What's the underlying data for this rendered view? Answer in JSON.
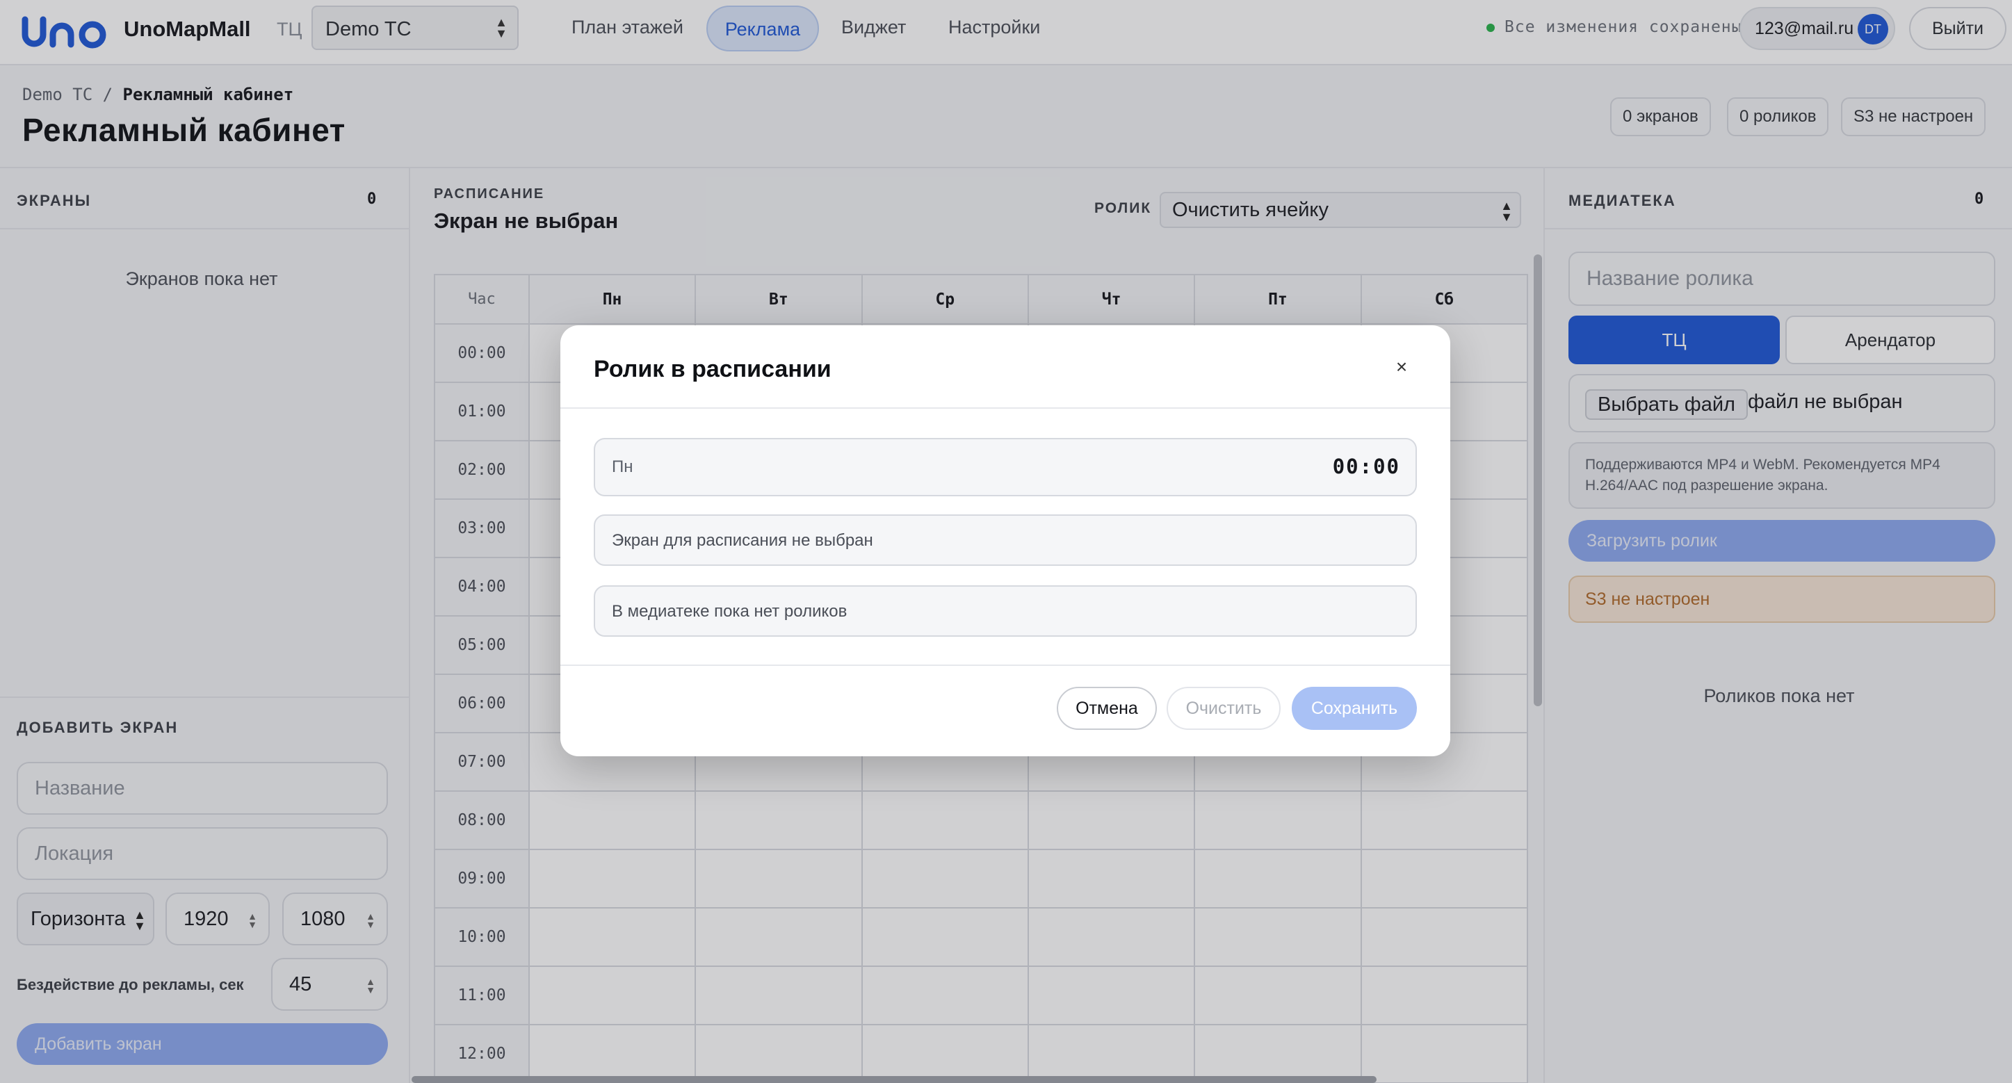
{
  "header": {
    "brand": "UnoMapMall",
    "tc_label": "ТЦ",
    "tc_selected": "Demo TC",
    "nav": [
      "План этажей",
      "Реклама",
      "Виджет",
      "Настройки"
    ],
    "nav_active": "Реклама",
    "saved_status": "Все изменения сохранены",
    "user_email": "123@mail.ru",
    "user_initials": "DT",
    "logout": "Выйти"
  },
  "page": {
    "breadcrumb_root": "Demo TC",
    "breadcrumb_sep": "/",
    "breadcrumb_current": "Рекламный кабинет",
    "title": "Рекламный кабинет",
    "stats": [
      "0 экранов",
      "0 роликов",
      "S3 не настроен"
    ]
  },
  "screens": {
    "title": "ЭКРАНЫ",
    "count": "0",
    "empty": "Экранов пока нет"
  },
  "add_screen": {
    "title": "ДОБАВИТЬ ЭКРАН",
    "name_placeholder": "Название",
    "location_placeholder": "Локация",
    "orientation": "Горизонта",
    "width": "1920",
    "height": "1080",
    "idle_label": "Бездействие до рекламы, сек",
    "idle_value": "45",
    "button": "Добавить экран"
  },
  "schedule": {
    "label": "РАСПИСАНИЕ",
    "title": "Экран не выбран",
    "rolik_label": "РОЛИК",
    "rolik_selected": "Очистить ячейку",
    "hour_header": "Час",
    "days": [
      "Пн",
      "Вт",
      "Ср",
      "Чт",
      "Пт",
      "Сб"
    ],
    "hours": [
      "00:00",
      "01:00",
      "02:00",
      "03:00",
      "04:00",
      "05:00",
      "06:00",
      "07:00",
      "08:00",
      "09:00",
      "10:00",
      "11:00",
      "12:00"
    ]
  },
  "media": {
    "title": "МЕДИАТЕКА",
    "count": "0",
    "name_placeholder": "Название ролика",
    "seg_tc": "ТЦ",
    "seg_tenant": "Арендатор",
    "file_button": "Выбрать файл",
    "file_none": "файл не выбран",
    "hint": "Поддерживаются MP4 и WebM. Рекомендуется MP4 H.264/AAC под разрешение экрана.",
    "upload": "Загрузить ролик",
    "s3_warning": "S3 не настроен",
    "empty": "Роликов пока нет"
  },
  "modal": {
    "title": "Ролик в расписании",
    "day": "Пн",
    "time": "00:00",
    "screen_text": "Экран для расписания не выбран",
    "media_text": "В медиатеке пока нет роликов",
    "cancel": "Отмена",
    "clear": "Очистить",
    "save": "Сохранить"
  },
  "colors": {
    "accent": "#1e58d6",
    "saved_dot": "#28b24b",
    "warning_bg": "#f6e6d7",
    "warning_text": "#b06a2a"
  }
}
